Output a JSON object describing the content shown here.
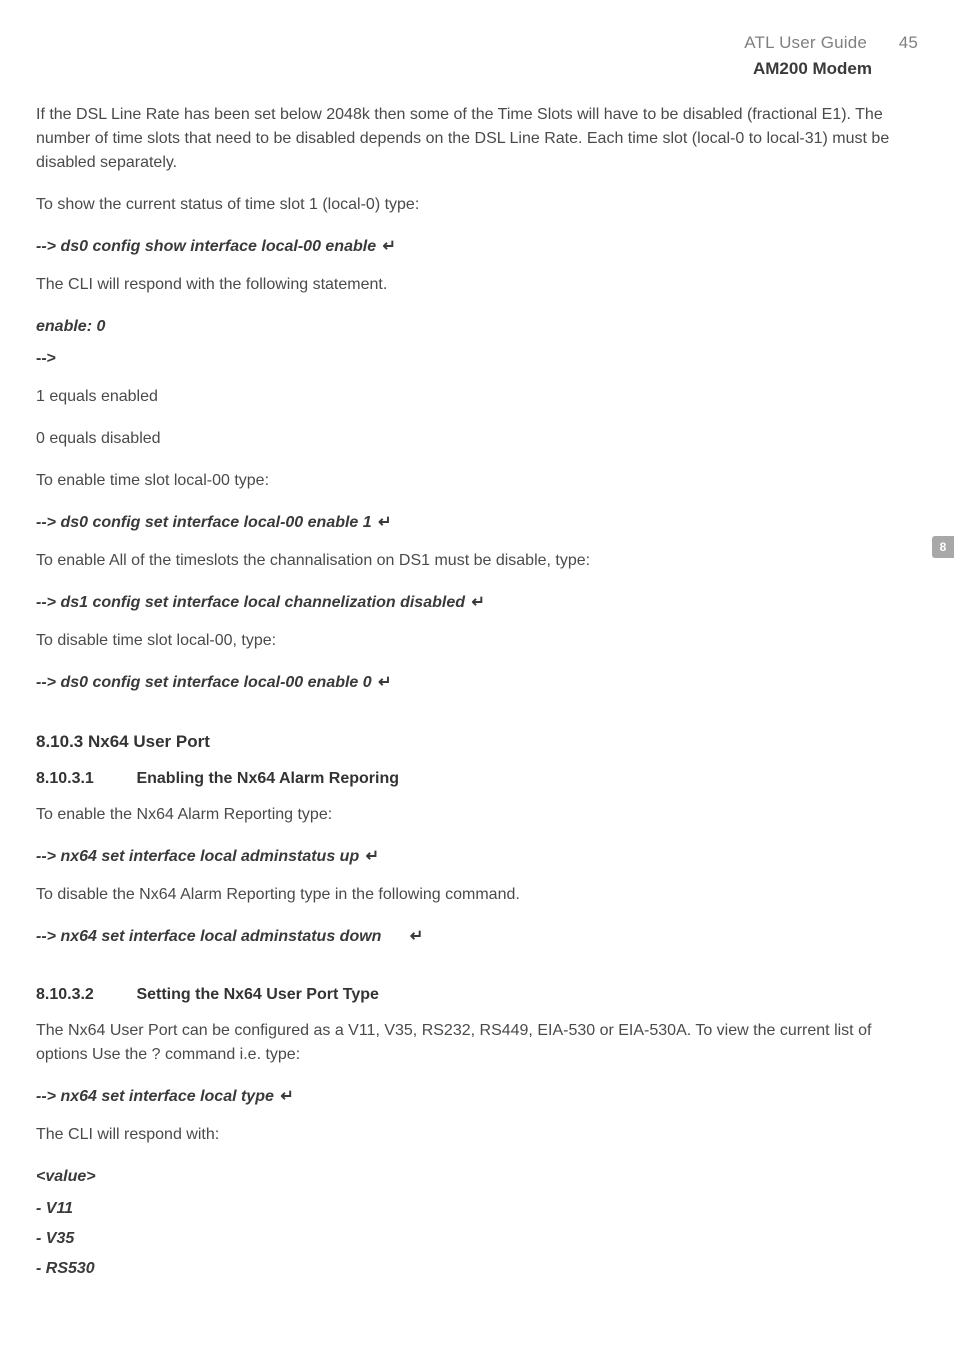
{
  "header": {
    "guide_title": "ATL User Guide",
    "page_number": "45",
    "product": "AM200 Modem"
  },
  "side_tab": "8",
  "body": {
    "p1": "If the DSL Line Rate has been set below 2048k then some of the Time Slots will have to be disabled (fractional E1). The number of time slots that need to be disabled depends on the DSL Line Rate. Each time slot (local-0 to local-31) must be disabled separately.",
    "p2": "To show the current status of time slot 1 (local-0) type:",
    "cmd1": "--> ds0 config show interface local-00 enable",
    "p3": "The CLI will respond with the following statement.",
    "resp1": "enable: 0",
    "prompt": "-->",
    "p4": "1 equals enabled",
    "p5": "0 equals disabled",
    "p6": "To enable time slot local-00 type:",
    "cmd2": "--> ds0 config set interface local-00 enable  1",
    "p7": "To enable All of the timeslots the channalisation on DS1 must be disable, type:",
    "cmd3": "--> ds1 config set interface local channelization disabled",
    "p8": "To disable time slot local-00, type:",
    "cmd4": "--> ds0 config set interface local-00 enable  0",
    "h3_1": "8.10.3 Nx64 User Port",
    "h4_1_num": "8.10.3.1",
    "h4_1_title": "Enabling the Nx64 Alarm Reporing",
    "p9": "To enable the Nx64 Alarm Reporting type:",
    "cmd5": "--> nx64 set interface local adminstatus up",
    "p10": "To disable the Nx64 Alarm Reporting type in the following command.",
    "cmd6": "--> nx64 set interface local adminstatus down",
    "h4_2_num": "8.10.3.2",
    "h4_2_title": "Setting the Nx64 User Port Type",
    "p11": "The Nx64 User Port can be configured as a V11, V35, RS232, RS449, EIA-530 or EIA-530A. To view the current list of options Use the ? command i.e. type:",
    "cmd7": "--> nx64 set interface local type",
    "p12": "The CLI will respond with:",
    "value_label": "<value>",
    "values": {
      "v0": " - V11",
      "v1": " - V35",
      "v2": " - RS530"
    },
    "enter_glyph": "↵"
  }
}
